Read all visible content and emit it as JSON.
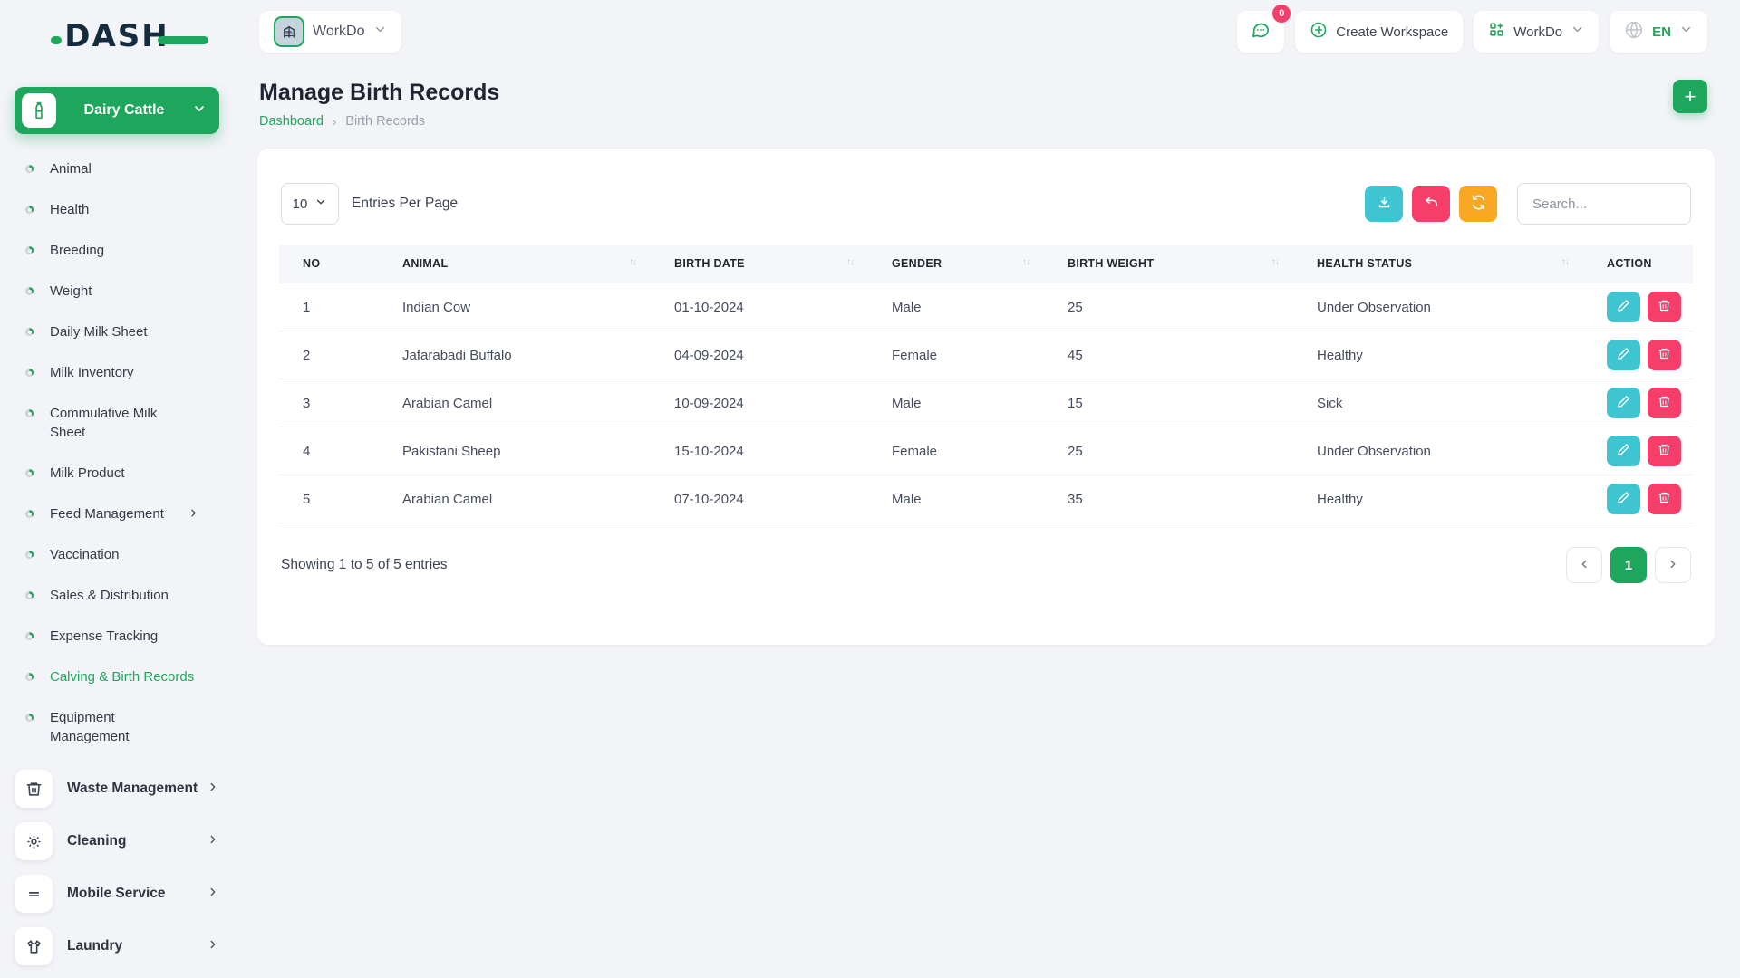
{
  "brand": {
    "logo_text": "DASH"
  },
  "topbar": {
    "workspace_selector": {
      "label": "WorkDo",
      "avatar_icon": "building-icon"
    },
    "messages": {
      "badge_count": "0",
      "icon": "chat-bubble-icon"
    },
    "create_workspace_label": "Create Workspace",
    "workdo_menu_label": "WorkDo",
    "language": {
      "code": "EN",
      "icon": "globe-icon"
    }
  },
  "sidebar": {
    "section_label": "Dairy Cattle",
    "section_icon": "milk-bottle-icon",
    "items": [
      {
        "label": "Animal",
        "active": false
      },
      {
        "label": "Health",
        "active": false
      },
      {
        "label": "Breeding",
        "active": false
      },
      {
        "label": "Weight",
        "active": false
      },
      {
        "label": "Daily Milk Sheet",
        "active": false
      },
      {
        "label": "Milk Inventory",
        "active": false
      },
      {
        "label": "Commulative Milk Sheet",
        "active": false
      },
      {
        "label": "Milk Product",
        "active": false
      },
      {
        "label": "Feed Management",
        "active": false,
        "has_submenu": true
      },
      {
        "label": "Vaccination",
        "active": false
      },
      {
        "label": "Sales & Distribution",
        "active": false
      },
      {
        "label": "Expense Tracking",
        "active": false
      },
      {
        "label": "Calving & Birth Records",
        "active": true
      },
      {
        "label": "Equipment Management",
        "active": false
      }
    ],
    "bottom_items": [
      {
        "label": "Waste Management",
        "icon": "trash-icon"
      },
      {
        "label": "Cleaning",
        "icon": "sun-icon"
      },
      {
        "label": "Mobile Service",
        "icon": "lines-icon"
      },
      {
        "label": "Laundry",
        "icon": "shirt-icon"
      }
    ]
  },
  "page": {
    "title": "Manage Birth Records",
    "breadcrumb": {
      "home": "Dashboard",
      "separator": "›",
      "current": "Birth Records"
    },
    "add_button_icon": "plus-icon"
  },
  "table_card": {
    "entries_per_page": {
      "value": "10",
      "label": "Entries Per Page"
    },
    "toolbar_buttons": [
      {
        "name": "export",
        "icon": "download-icon",
        "color": "#3fc5d2"
      },
      {
        "name": "back",
        "icon": "undo-icon",
        "color": "#f73d6a"
      },
      {
        "name": "refresh",
        "icon": "refresh-icon",
        "color": "#f9a826"
      }
    ],
    "search_placeholder": "Search...",
    "columns": {
      "no": "NO",
      "animal": "ANIMAL",
      "birth_date": "BIRTH DATE",
      "gender": "GENDER",
      "birth_weight": "BIRTH WEIGHT",
      "health_status": "HEALTH STATUS",
      "action": "ACTION"
    },
    "sort_glyph": "↑↓",
    "rows": [
      {
        "no": "1",
        "animal": "Indian Cow",
        "birth_date": "01-10-2024",
        "gender": "Male",
        "birth_weight": "25",
        "health_status": "Under Observation"
      },
      {
        "no": "2",
        "animal": "Jafarabadi Buffalo",
        "birth_date": "04-09-2024",
        "gender": "Female",
        "birth_weight": "45",
        "health_status": "Healthy"
      },
      {
        "no": "3",
        "animal": "Arabian Camel",
        "birth_date": "10-09-2024",
        "gender": "Male",
        "birth_weight": "15",
        "health_status": "Sick"
      },
      {
        "no": "4",
        "animal": "Pakistani Sheep",
        "birth_date": "15-10-2024",
        "gender": "Female",
        "birth_weight": "25",
        "health_status": "Under Observation"
      },
      {
        "no": "5",
        "animal": "Arabian Camel",
        "birth_date": "07-10-2024",
        "gender": "Male",
        "birth_weight": "35",
        "health_status": "Healthy"
      }
    ],
    "footer": {
      "showing_text": "Showing 1 to 5 of 5 entries",
      "current_page": "1"
    }
  },
  "colors": {
    "primary_green": "#1ea75c",
    "teal": "#3fc5d2",
    "pink": "#f73d6a",
    "orange": "#f9a826",
    "navy": "#152c3e"
  }
}
